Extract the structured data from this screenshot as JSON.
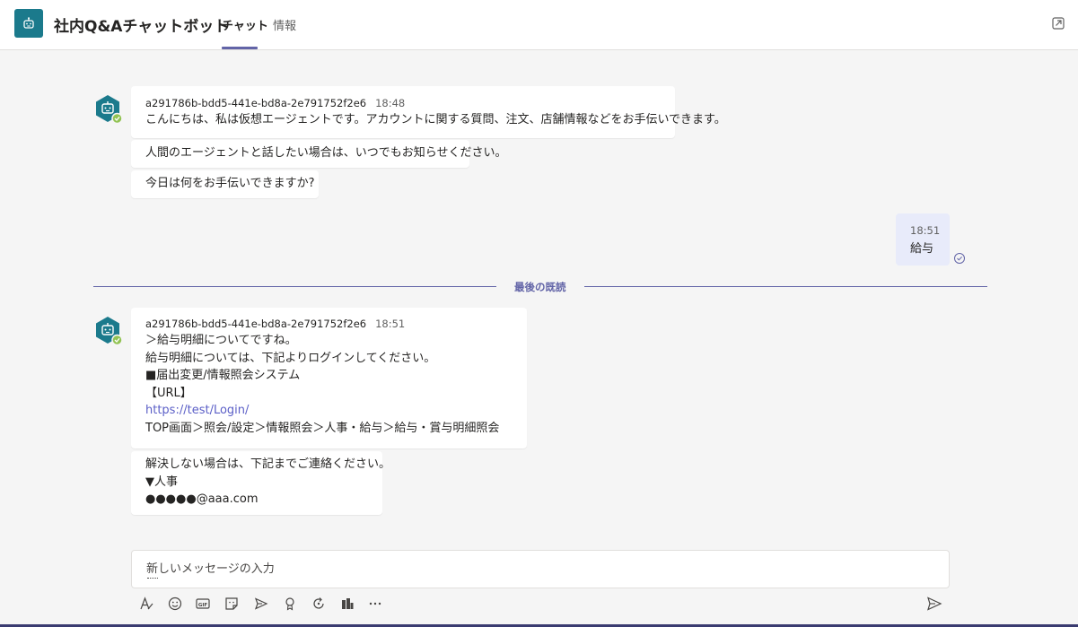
{
  "header": {
    "app_title": "社内Q&Aチャットボット",
    "tabs": [
      {
        "label": "チャット",
        "active": true
      },
      {
        "label": "情報",
        "active": false
      }
    ],
    "app_icon": "bot-icon",
    "popout_icon": "popout-icon"
  },
  "colors": {
    "accent": "#6264a7",
    "app_icon_bg": "#1b7a8c",
    "status_available": "#92c353",
    "link": "#5b5fc7",
    "my_bubble": "#e8ebfa"
  },
  "messages": {
    "group1": {
      "sender": "a291786b-bdd5-441e-bd8a-2e791752f2e6",
      "time": "18:48",
      "bubbles": [
        "こんにちは、私は仮想エージェントです。アカウントに関する質問、注文、店舗情報などをお手伝いできます。",
        "人間のエージェントと話したい場合は、いつでもお知らせください。",
        "今日は何をお手伝いできますか?"
      ]
    },
    "my_message": {
      "time": "18:51",
      "text": "給与"
    },
    "divider": "最後の既読",
    "group2": {
      "sender": "a291786b-bdd5-441e-bd8a-2e791752f2e6",
      "time": "18:51",
      "bubble1_lines": [
        "＞給与明細についてですね。",
        "給与明細については、下記よりログインしてください。",
        "■届出変更/情報照会システム",
        "【URL】"
      ],
      "link": "https://test/Login/",
      "bubble1_last": "TOP画面＞照会/設定＞情報照会＞人事・給与＞給与・賞与明細照会",
      "bubble2_lines": [
        "解決しない場合は、下記までご連絡ください。",
        "▼人事",
        "●●●●●@aaa.com"
      ]
    }
  },
  "compose": {
    "placeholder": "新しいメッセージの入力",
    "tools": [
      "format-icon",
      "emoji-icon",
      "gif-icon",
      "sticker-icon",
      "meet-now-icon",
      "praise-icon",
      "loop-icon",
      "apps-icon",
      "more-options-icon"
    ],
    "send_icon": "send-icon"
  }
}
